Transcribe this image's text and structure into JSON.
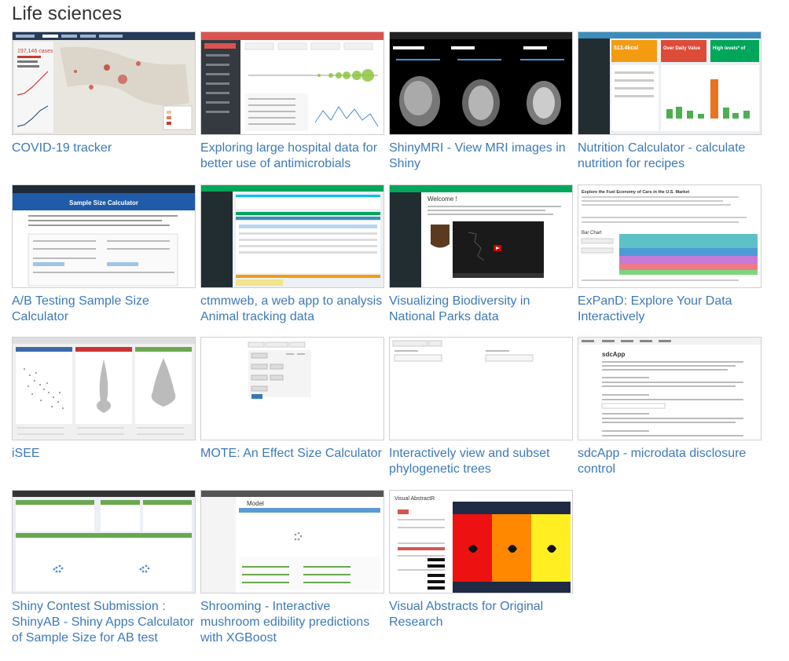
{
  "section_title": "Life sciences",
  "colors": {
    "link": "#3c7ab8",
    "title": "#333333",
    "thumb_border": "#cfcfcf"
  },
  "cards": [
    {
      "title": "COVID-19 tracker"
    },
    {
      "title": "Exploring large hospital data for better use of antimicrobials"
    },
    {
      "title": "ShinyMRI - View MRI images in Shiny"
    },
    {
      "title": "Nutrition Calculator - calculate nutrition for recipes"
    },
    {
      "title": "A/B Testing Sample Size Calculator"
    },
    {
      "title": "ctmmweb, a web app to analysis Animal tracking data"
    },
    {
      "title": "Visualizing Biodiversity in National Parks data"
    },
    {
      "title": "ExPanD: Explore Your Data Interactively"
    },
    {
      "title": "iSEE"
    },
    {
      "title": "MOTE: An Effect Size Calculator"
    },
    {
      "title": "Interactively view and subset phylogenetic trees"
    },
    {
      "title": "sdcApp - microdata disclosure control"
    },
    {
      "title": "Shiny Contest Submission : ShinyAB - Shiny Apps Calculator of Sample Size for AB test"
    },
    {
      "title": "Shrooming - Interactive mushroom edibility predictions with XGBoost"
    },
    {
      "title": "Visual Abstracts for Original Research"
    }
  ],
  "thumbs": {
    "covid": {
      "stat": "197,146 cases"
    },
    "nutrition": {
      "kcal": "513.4kcal",
      "daily": "Over Daily Value",
      "high": "High levels* of"
    },
    "ab": {
      "heading": "Sample Size Calculator"
    },
    "parks": {
      "welcome": "Welcome !"
    },
    "expand": {
      "heading": "Explore the Fuel Economy of Cars in the U.S. Market",
      "sub": "Bar Chart"
    },
    "sdc": {
      "heading": "sdcApp"
    },
    "shrooming": {
      "heading": "Model"
    },
    "visual": {
      "heading": "Visual AbstractR"
    }
  }
}
